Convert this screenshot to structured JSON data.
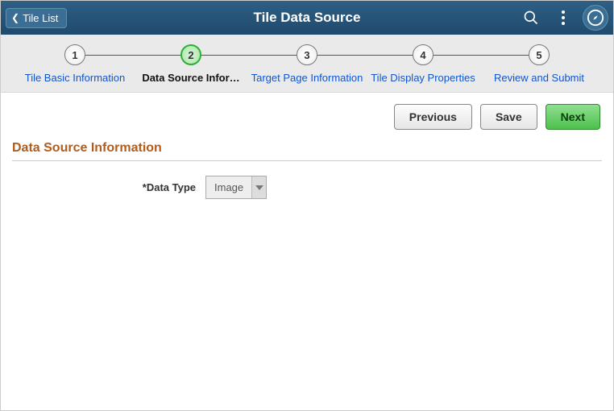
{
  "header": {
    "back_label": "Tile List",
    "title": "Tile Data Source"
  },
  "steps": [
    {
      "num": "1",
      "label": "Tile Basic Information"
    },
    {
      "num": "2",
      "label": "Data Source Infor…"
    },
    {
      "num": "3",
      "label": "Target Page Information"
    },
    {
      "num": "4",
      "label": "Tile Display Properties"
    },
    {
      "num": "5",
      "label": "Review and Submit"
    }
  ],
  "actions": {
    "previous": "Previous",
    "save": "Save",
    "next": "Next"
  },
  "section": {
    "title": "Data Source Information",
    "data_type_label": "*Data Type",
    "data_type_value": "Image"
  }
}
